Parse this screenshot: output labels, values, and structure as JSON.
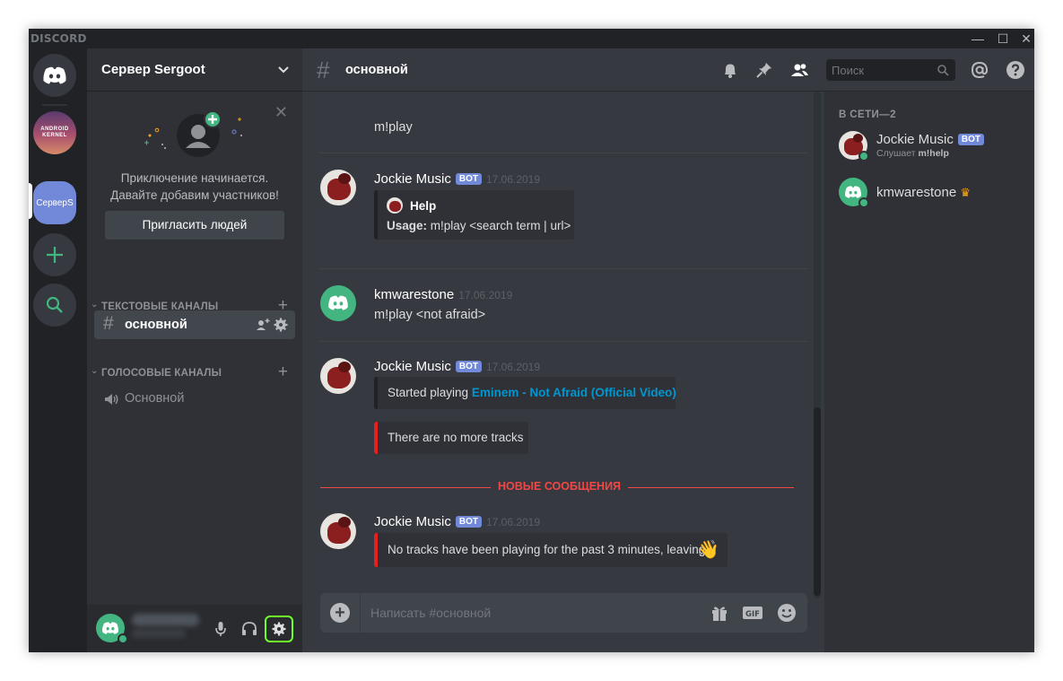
{
  "app": {
    "logo": "DISCORD"
  },
  "window_controls": [
    "—",
    "☐",
    "✕"
  ],
  "guilds": [
    {
      "name": "home",
      "icon": "discord-logo-icon"
    },
    {
      "name": "android-kernel",
      "label": "ANDROID KERNEL"
    },
    {
      "name": "server",
      "label": "СерверS"
    },
    {
      "name": "add-server",
      "icon": "plus-icon"
    },
    {
      "name": "explore",
      "icon": "search-icon"
    }
  ],
  "server": {
    "name": "Сервер Sergoot"
  },
  "invite": {
    "line1": "Приключение начинается.",
    "line2": "Давайте добавим участников!",
    "button": "Пригласить людей"
  },
  "categories": {
    "text": "ТЕКСТОВЫЕ КАНАЛЫ",
    "voice": "ГОЛОСОВЫЕ КАНАЛЫ"
  },
  "channels": {
    "text": "основной",
    "voice": "Основной"
  },
  "header": {
    "channel": "основной",
    "search_placeholder": "Поиск"
  },
  "messages": {
    "top_text": "m!play",
    "m1": {
      "author": "Jockie Music",
      "badge": "BOT",
      "time": "17.06.2019",
      "embed_title": "Help",
      "usage_label": "Usage:",
      "usage_text": " m!play <search term | url>"
    },
    "m2": {
      "author": "kmwarestone",
      "time": "17.06.2019",
      "text": "m!play <not afraid>"
    },
    "m3": {
      "author": "Jockie Music",
      "badge": "BOT",
      "time": "17.06.2019",
      "embed1_prefix": "Started playing ",
      "embed1_link": "Eminem - Not Afraid (Official Video)",
      "embed2": "There are no more tracks"
    },
    "new_messages": "НОВЫЕ СООБЩЕНИЯ",
    "m4": {
      "author": "Jockie Music",
      "badge": "BOT",
      "time": "17.06.2019",
      "embed": "No tracks have been playing for the past 3 minutes, leaving",
      "emoji": "👋"
    }
  },
  "composer": {
    "placeholder": "Написать #основной"
  },
  "members": {
    "header": "В СЕТИ—2",
    "list": [
      {
        "name": "Jockie Music",
        "badge": "BOT",
        "activity_prefix": "Слушает ",
        "activity": "m!help"
      },
      {
        "name": "kmwarestone",
        "crown": "♛"
      }
    ]
  },
  "colors": {
    "accent": "#7289da",
    "online": "#43b581",
    "danger": "#f04747",
    "link": "#0096cf",
    "highlight": "#6eff2b"
  }
}
